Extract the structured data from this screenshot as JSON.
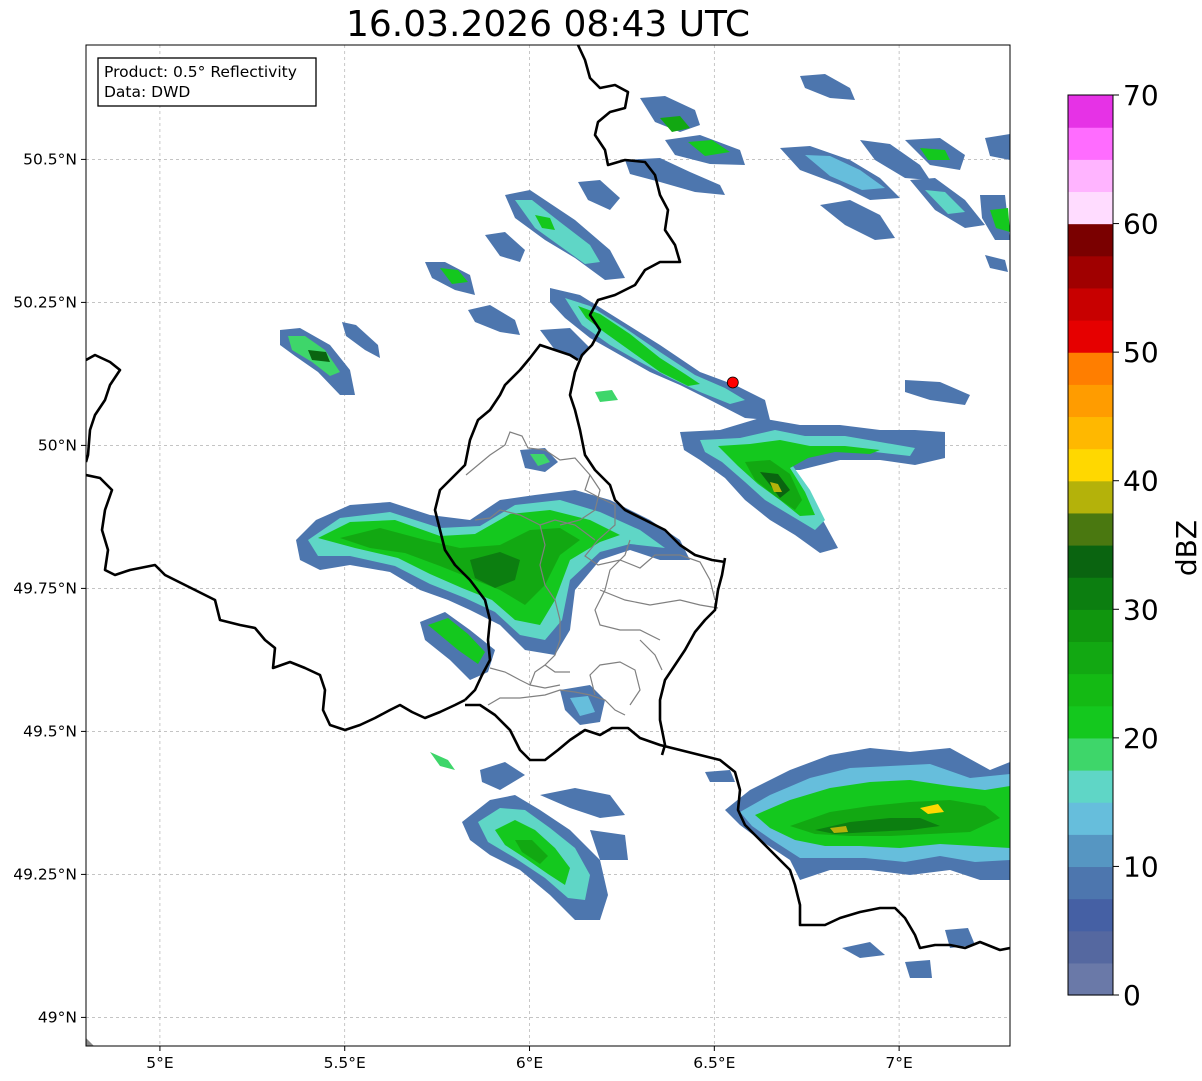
{
  "title": "16.03.2026 08:43 UTC",
  "info": {
    "product": "Product: 0.5° Reflectivity",
    "data": "Data: DWD"
  },
  "axes": {
    "x_ticks": [
      "5°E",
      "5.5°E",
      "6°E",
      "6.5°E",
      "7°E"
    ],
    "x_tick_values": [
      5.0,
      5.5,
      6.0,
      6.5,
      7.0
    ],
    "y_ticks": [
      "50.5°N",
      "50.25°N",
      "50°N",
      "49.75°N",
      "49.5°N",
      "49.25°N",
      "49°N"
    ],
    "y_tick_values": [
      50.5,
      50.25,
      50.0,
      49.75,
      49.5,
      49.25,
      49.0
    ],
    "lon_range": [
      4.8,
      7.3
    ],
    "lat_range": [
      48.95,
      50.7
    ],
    "grid": true
  },
  "radar_site": {
    "lon": 6.55,
    "lat": 50.11,
    "color": "#ff0000"
  },
  "colorbar": {
    "label": "dBZ",
    "tick_labels": [
      "0",
      "10",
      "20",
      "30",
      "40",
      "50",
      "60",
      "70"
    ],
    "tick_values": [
      0,
      10,
      20,
      30,
      40,
      50,
      60,
      70
    ],
    "range": [
      0,
      70
    ],
    "step": 2.5,
    "colors": [
      "#6a79a8",
      "#5568a0",
      "#4560a4",
      "#4d76ae",
      "#5696c2",
      "#66bedc",
      "#5fd6c6",
      "#3ed66a",
      "#14c81e",
      "#14ba14",
      "#12a812",
      "#10960e",
      "#0c7e10",
      "#0a6410",
      "#4a7810",
      "#b4b20a",
      "#ffd800",
      "#ffb800",
      "#ff9c00",
      "#ff7e00",
      "#e60000",
      "#c80000",
      "#a00000",
      "#7a0000",
      "#ffdcff",
      "#ffb4ff",
      "#ff6cff",
      "#e632e6"
    ]
  }
}
